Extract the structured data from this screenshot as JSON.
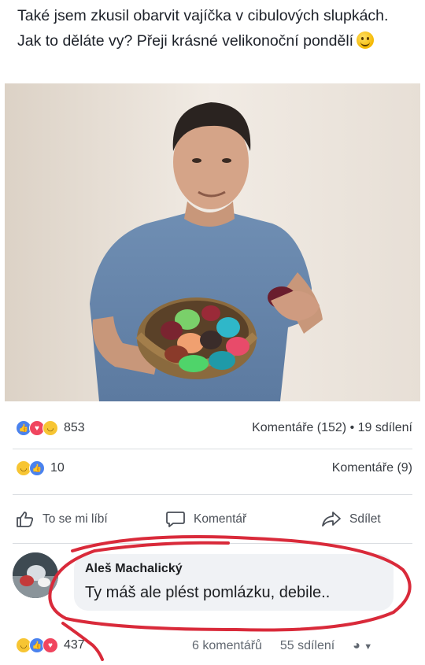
{
  "post": {
    "text": "Také jsem zkusil obarvit vajíčka v cibulových slupkách. Jak to děláte vy? Přeji krásné velikonoční pondělí",
    "emoji": "slightly-smiling-face-icon"
  },
  "stats_1": {
    "reaction_count": "853",
    "comments_shares": "Komentáře (152) • 19 sdílení"
  },
  "stats_2": {
    "reaction_count": "10",
    "comments": "Komentáře (9)"
  },
  "actions": {
    "like": "To se mi líbí",
    "comment": "Komentář",
    "share": "Sdílet"
  },
  "comment": {
    "author": "Aleš Machalický",
    "text": "Ty máš ale plést pomlázku, debile.."
  },
  "bottom": {
    "reaction_count": "437",
    "comments": "6 komentářů",
    "shares": "55 sdílení"
  },
  "colors": {
    "like_blue": "#4a82ee",
    "love_red": "#f0455e",
    "haha_yellow": "#f7c533",
    "annotation_red": "#d92a3a"
  }
}
